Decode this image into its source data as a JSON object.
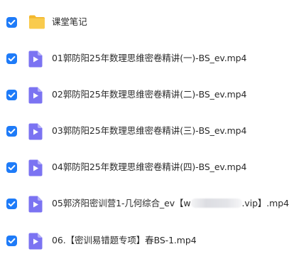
{
  "colors": {
    "checkbox": "#1e7bf8",
    "folder": "#f6c342",
    "video_icon": "#7b73f2",
    "text": "#2a2a2a"
  },
  "files": [
    {
      "type": "folder",
      "icon": "folder-icon",
      "name": "课堂笔记",
      "checked": true
    },
    {
      "type": "video",
      "icon": "video-file-icon",
      "name": "01郭防阳25年数理思维密卷精讲(一)-BS_ev.mp4",
      "checked": true
    },
    {
      "type": "video",
      "icon": "video-file-icon",
      "name": "02郭防阳25年数理思维密卷精讲(二)-BS_ev.mp4",
      "checked": true
    },
    {
      "type": "video",
      "icon": "video-file-icon",
      "name": "03郭防阳25年数理思维密卷精讲(三)-BS_ev.mp4",
      "checked": true
    },
    {
      "type": "video",
      "icon": "video-file-icon",
      "name": "04郭防阳25年数理思维密卷精讲(四)-BS_ev.mp4",
      "checked": true
    },
    {
      "type": "video",
      "icon": "video-file-icon",
      "name_prefix": "05郭济阳密训营1-几何综合_ev【w",
      "name_suffix": ".vip】.mp4",
      "checked": true
    },
    {
      "type": "video",
      "icon": "video-file-icon",
      "name": "06.【密训易错题专项】春BS-1.mp4",
      "checked": true
    }
  ]
}
